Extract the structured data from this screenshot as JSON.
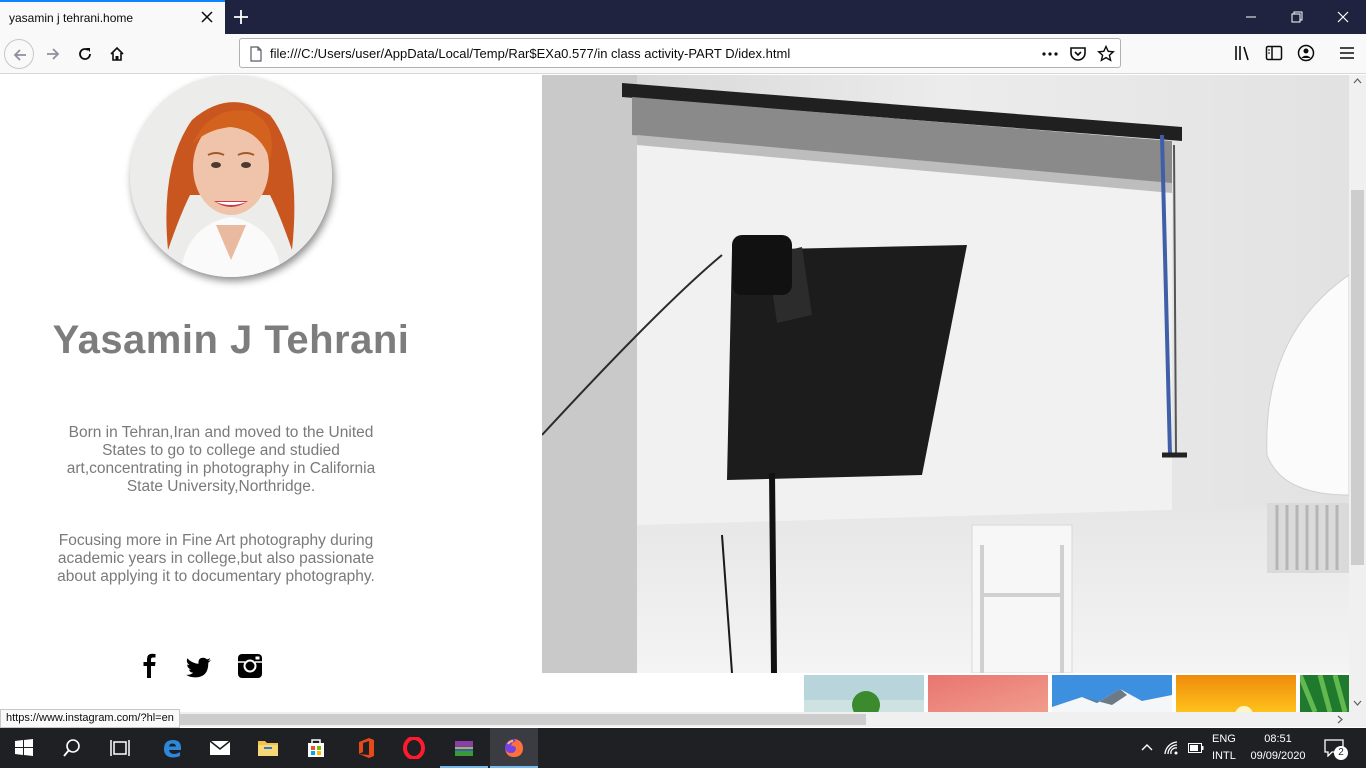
{
  "browser": {
    "tab_title": "yasamin j tehrani.home",
    "url": "file:///C:/Users/user/AppData/Local/Temp/Rar$EXa0.577/in class activity-PART D/idex.html",
    "status_url": "https://www.instagram.com/?hl=en"
  },
  "profile": {
    "name": "Yasamin J Tehrani",
    "bio": [
      "Born in Tehran,Iran and moved to the United States to go to college and studied art,concentrating in photography in California State University,Northridge.",
      "Focusing more in Fine Art photography during academic years in college,but also passionate about applying it to documentary photography."
    ],
    "social_icons": [
      "facebook-icon",
      "twitter-icon",
      "instagram-icon"
    ]
  },
  "gallery": {
    "thumbnails": [
      "green-tree",
      "pink-sky",
      "blue-mountains",
      "orange-sunset",
      "green-forest"
    ]
  },
  "taskbar": {
    "lang_top": "ENG",
    "lang_bottom": "INTL",
    "time": "08:51",
    "date": "09/09/2020",
    "notification_count": "2"
  },
  "colors": {
    "accent": "#0a84ff",
    "text_gray": "#7d7d7d",
    "tab_bar": "#202340",
    "taskbar": "#1f2023"
  }
}
